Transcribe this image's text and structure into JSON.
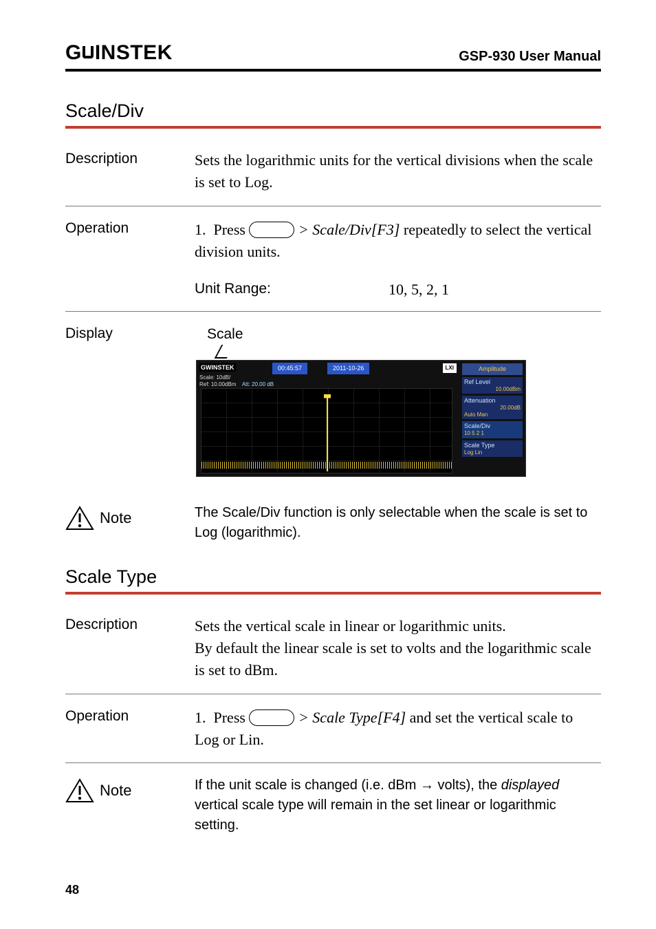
{
  "header": {
    "brand_left": "G",
    "brand_right": "INSTEK",
    "manual": "GSP-930 User Manual"
  },
  "sec1": {
    "title": "Scale/Div",
    "desc_label": "Description",
    "desc_text": "Sets the logarithmic units for the vertical divisions when the scale is set to Log.",
    "op_label": "Operation",
    "op_num": "1.",
    "op_press": "Press",
    "op_menu": "> Scale/Div[F3]",
    "op_tail": " repeatedly to select the vertical division units.",
    "unit_label": "Unit Range:",
    "unit_value": "10, 5, 2, 1",
    "display_label": "Display",
    "display_caption": "Scale",
    "note_label": "Note",
    "note_text": "The Scale/Div function is only selectable when the scale is set to Log (logarithmic)."
  },
  "shot": {
    "brand": "GWINSTEK",
    "time": "00:45:57",
    "date": "2011-10-26",
    "scale_line": "Scale: 10dB/",
    "ref_line": "Ref: 10.00dBm",
    "att": "Att: 20.00 dB",
    "lxi": "LXI",
    "menu_head": "Amplitude",
    "m1": "Ref Level",
    "m1v": "10.00dBm",
    "m2": "Attenuation",
    "m2v": "20.00dB",
    "m2row": "Auto    Man",
    "m3": "Scale/Div",
    "m3row": "10  5  2  1",
    "m4": "Scale Type",
    "m4row": "Log    Lin"
  },
  "sec2": {
    "title": "Scale Type",
    "desc_label": "Description",
    "desc_text1": "Sets the vertical scale in linear or logarithmic units.",
    "desc_text2": "By default the linear scale is set to volts and the logarithmic scale is set to dBm.",
    "op_label": "Operation",
    "op_num": "1.",
    "op_press": "Press",
    "op_menu": "> Scale Type[F4]",
    "op_tail": " and set the vertical scale to Log or Lin.",
    "note_label": "Note",
    "note_text1": "If the unit scale is changed (i.e. dBm → volts), the ",
    "note_italic": "displayed",
    "note_text2": " vertical scale type will remain in the set linear or logarithmic setting."
  },
  "page": "48"
}
